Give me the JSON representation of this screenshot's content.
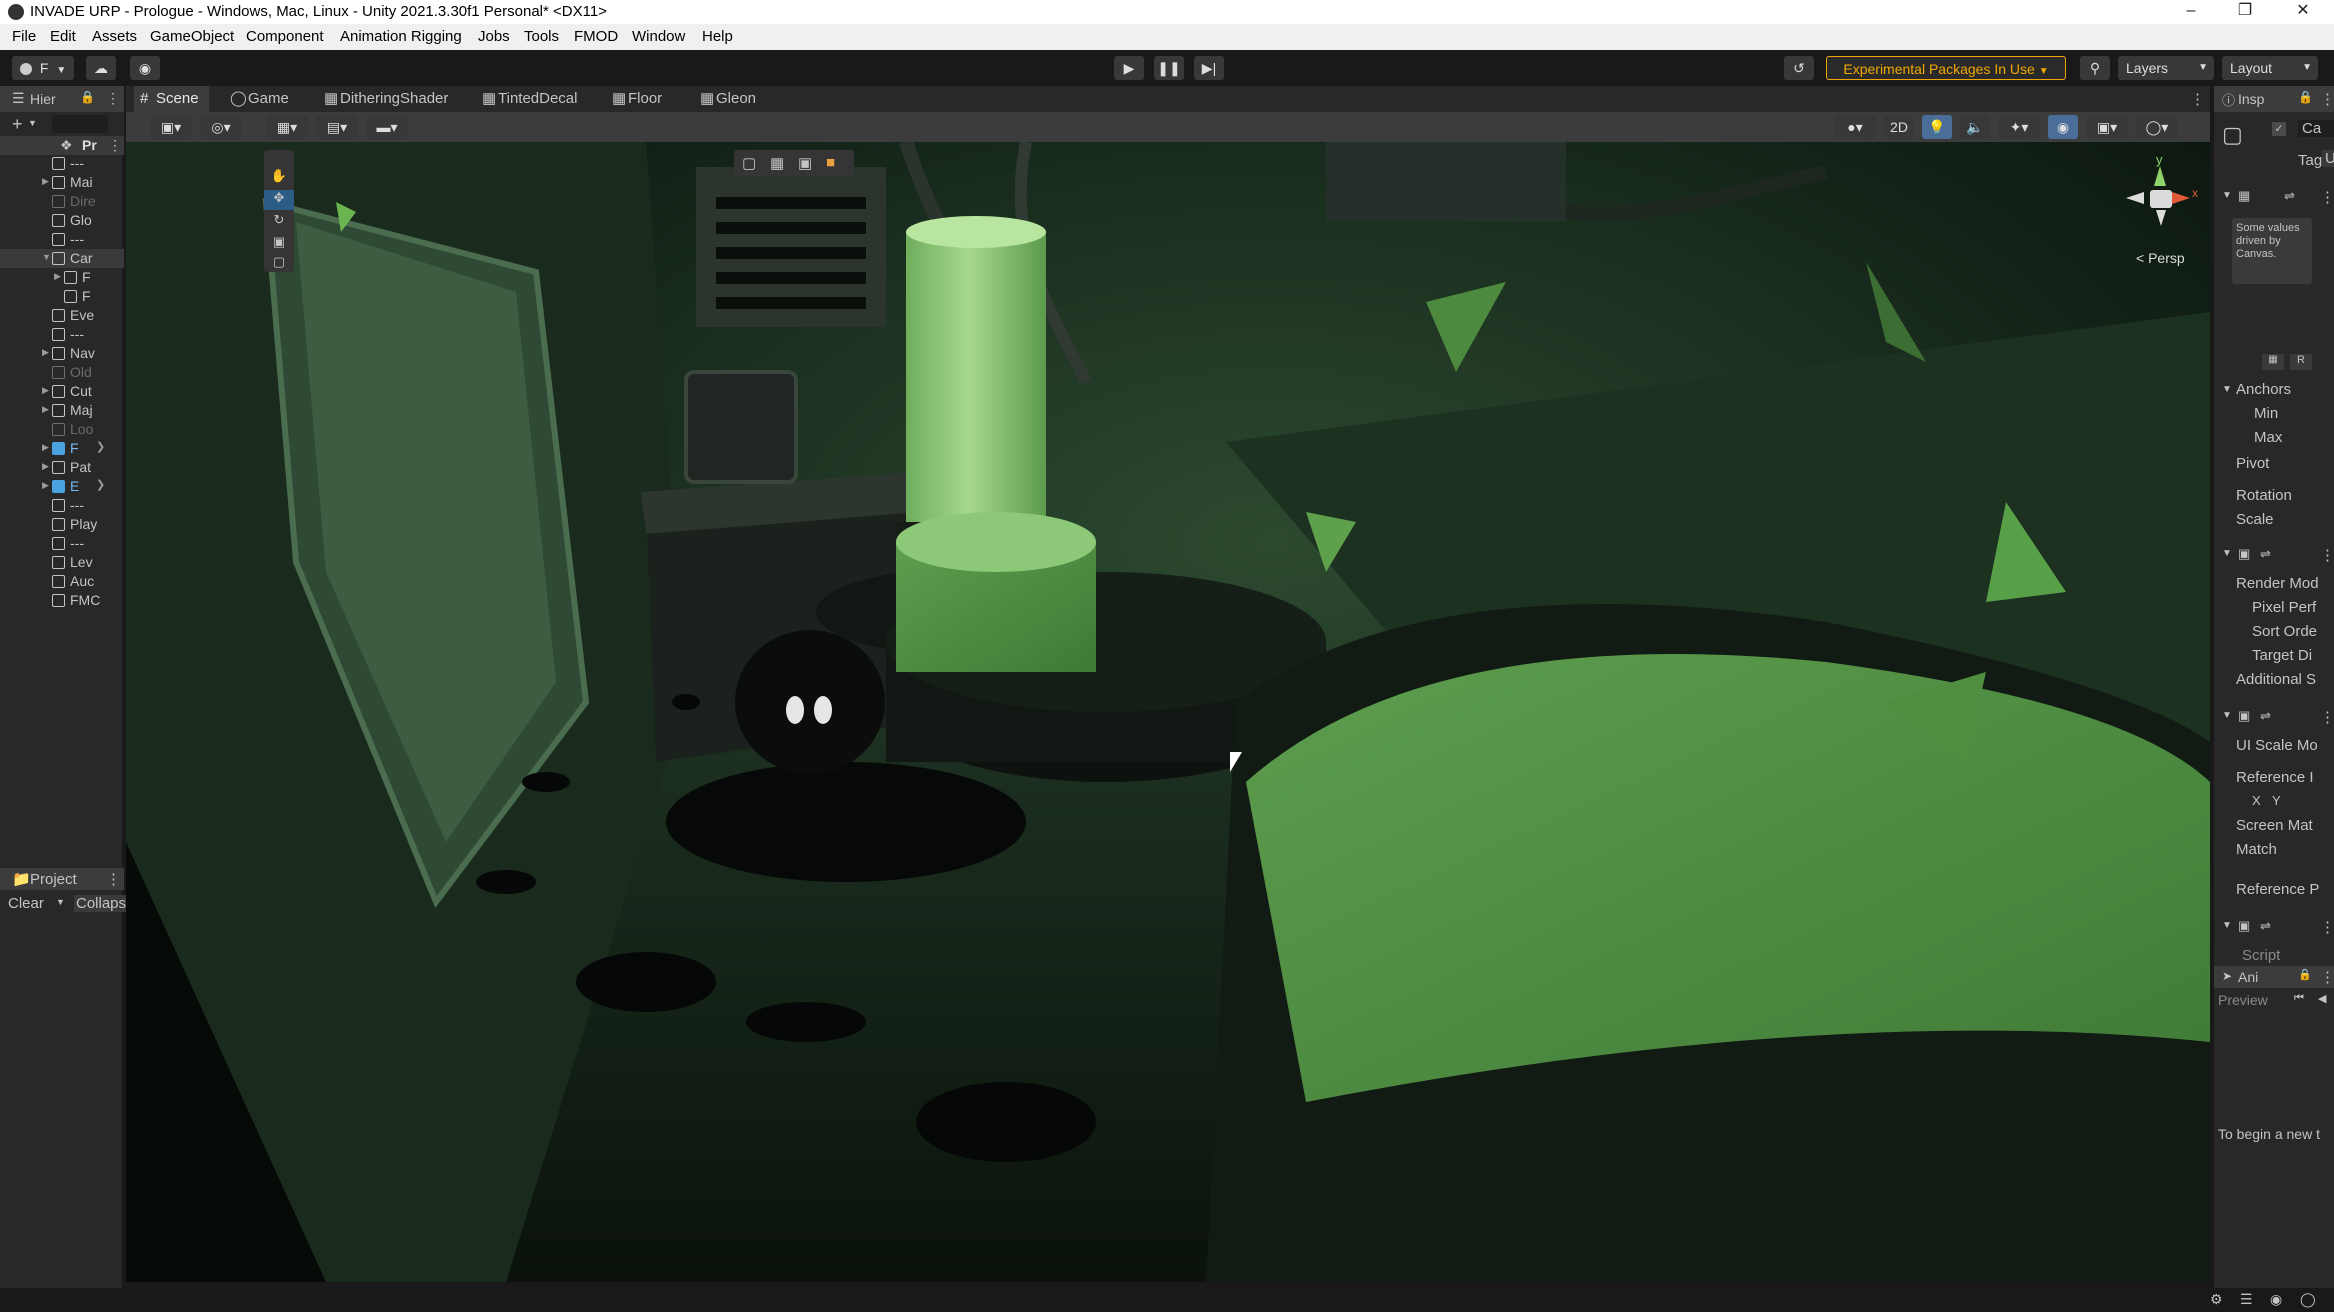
{
  "window": {
    "title": "INVADE URP - Prologue - Windows, Mac, Linux - Unity 2021.3.30f1 Personal* <DX11>",
    "minimize": "–",
    "maximize": "❐",
    "close": "✕"
  },
  "menu": [
    "File",
    "Edit",
    "Assets",
    "GameObject",
    "Component",
    "Animation Rigging",
    "Jobs",
    "Tools",
    "FMOD",
    "Window",
    "Help"
  ],
  "toolbar": {
    "account_label": "F",
    "experimental_label": "Experimental Packages In Use",
    "layers_label": "Layers",
    "layout_label": "Layout"
  },
  "hierarchy": {
    "tab_label": "Hier",
    "scene_root": "Pr",
    "items": [
      "---",
      "Mai",
      "Dire",
      "Glo",
      "---",
      "Car",
      "F",
      "F",
      "Eve",
      "---",
      "Nav",
      "Old",
      "Cut",
      "Maj",
      "Loo",
      "F",
      "Pat",
      "E",
      "---",
      "Play",
      "---",
      "Lev",
      "Auc",
      "FMC"
    ]
  },
  "project": {
    "tab_label": "Project",
    "clear_label": "Clear",
    "collapse_label": "Collaps"
  },
  "scene": {
    "tabs": [
      "Scene",
      "Game",
      "DitheringShader",
      "TintedDecal",
      "Floor",
      "Gleon"
    ],
    "active_tab": "Scene",
    "toggle_2d": "2D",
    "persp_label": "Persp",
    "gizmo_x": "x",
    "gizmo_y": "y"
  },
  "inspector": {
    "tab_label": "Insp",
    "name_short": "Ca",
    "tag_label": "Tag",
    "tag_value": "Ur",
    "note": "Some values driven by Canvas.",
    "rect_labels": [
      "Anchors",
      "Min",
      "Max",
      "Pivot",
      "Rotation",
      "Scale"
    ],
    "canvas_labels": [
      "Render Mod",
      "Pixel Perf",
      "Sort Orde",
      "Target Di",
      "Additional S"
    ],
    "scaler_labels": [
      "UI Scale Mo",
      "Reference I",
      "X",
      "Y",
      "Screen Mat",
      "Match",
      "Reference P"
    ],
    "script_label": "Script",
    "anim_tab": "Ani",
    "preview_label": "Preview",
    "begin_text": "To begin a new t",
    "r_label": "R"
  },
  "colors": {
    "experimental": "#f0a800",
    "scene_green": "#6fae5c",
    "editor_bg": "#282828",
    "selection": "#2c5d87"
  }
}
